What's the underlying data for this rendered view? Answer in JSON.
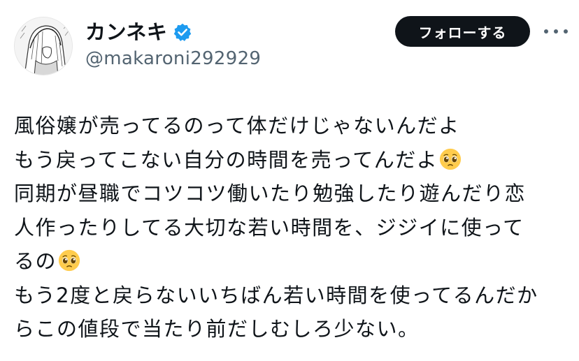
{
  "user": {
    "display_name": "カンネキ",
    "handle": "@makaroni292929",
    "verified_color": "#1d9bf0",
    "avatar_icon": "avatar-manga-illustration"
  },
  "actions": {
    "follow_label": "フォローする",
    "more_icon": "more-dots-icon"
  },
  "tweet": {
    "lines": [
      {
        "text": "風俗嬢が売ってるのって体だけじゃないんだよ",
        "emoji": ""
      },
      {
        "text": "もう戻ってこない自分の時間を売ってんだよ",
        "emoji": "pleading-face"
      },
      {
        "text": "同期が昼職でコツコツ働いたり勉強したり遊んだり恋",
        "emoji": ""
      },
      {
        "text": "人作ったりしてる大切な若い時間を、ジジイに使って",
        "emoji": ""
      },
      {
        "text": "るの",
        "emoji": "pleading-face"
      },
      {
        "text": "もう2度と戻らないいちばん若い時間を使ってるんだか",
        "emoji": ""
      },
      {
        "text": "らこの値段で当たり前だしむしろ少ない。",
        "emoji": ""
      }
    ]
  },
  "colors": {
    "text": "#0f1419",
    "secondary": "#536471",
    "button_bg": "#0f1419",
    "button_text": "#ffffff",
    "emoji_face": "#ffcc4d"
  }
}
